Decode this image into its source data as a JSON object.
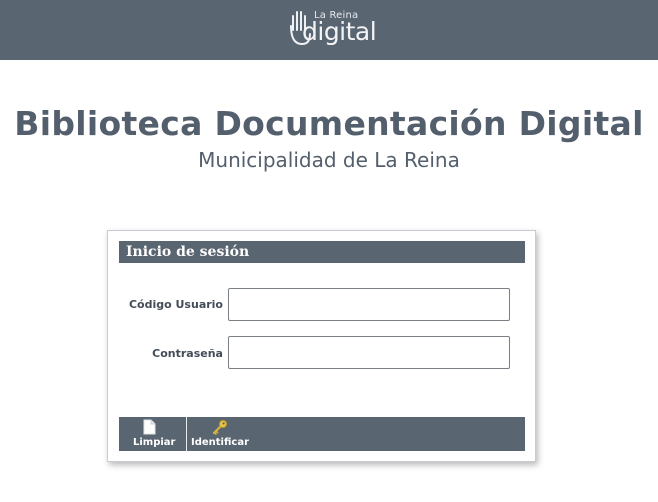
{
  "brand": {
    "logo_small": "La Reina",
    "logo_big": "digital",
    "bar_color": "#5a6572"
  },
  "page": {
    "title": "Biblioteca Documentación Digital",
    "subtitle": "Municipalidad de La Reina"
  },
  "login": {
    "header": "Inicio de sesión",
    "user_label": "Código Usuario",
    "user_value": "",
    "password_label": "Contraseña",
    "password_value": "",
    "buttons": {
      "clear_label": "Limpiar",
      "clear_icon": "document-icon",
      "submit_label": "Identificar",
      "submit_icon": "key-icon"
    }
  }
}
